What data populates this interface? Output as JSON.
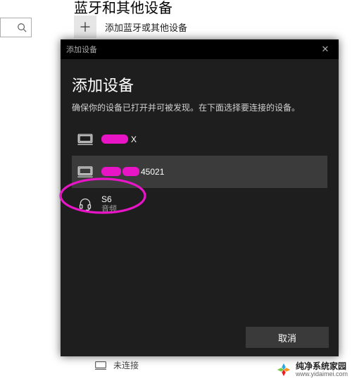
{
  "background": {
    "partial_title": "蓝牙和其他设备",
    "add_bt_label": "添加蓝牙或其他设备",
    "plus_glyph": "＋",
    "search_icon_name": "search-icon"
  },
  "dialog": {
    "titlebar": "添加设备",
    "close_glyph": "✕",
    "heading": "添加设备",
    "subtext": "确保你的设备已打开并可被发现。在下面选择要连接的设备。",
    "devices": [
      {
        "icon": "display-icon",
        "name_visible_suffix": "X",
        "redacted": true,
        "highlight": false
      },
      {
        "icon": "display-icon",
        "name_visible_suffix": "45021",
        "redacted": true,
        "highlight": true
      },
      {
        "icon": "headset-icon",
        "name": "S6",
        "subtype": "音频",
        "highlight": false,
        "annotated": true
      }
    ],
    "cancel_label": "取消"
  },
  "status": {
    "text": "未连接"
  },
  "watermark": {
    "line1": "纯净系统家园",
    "line2": "www.yidaimei.com"
  },
  "colors": {
    "dialog_bg": "#1e1e1e",
    "highlight_row": "#3b3b3b",
    "redaction": "#e815c7",
    "annotation_stroke": "#e815c7"
  }
}
